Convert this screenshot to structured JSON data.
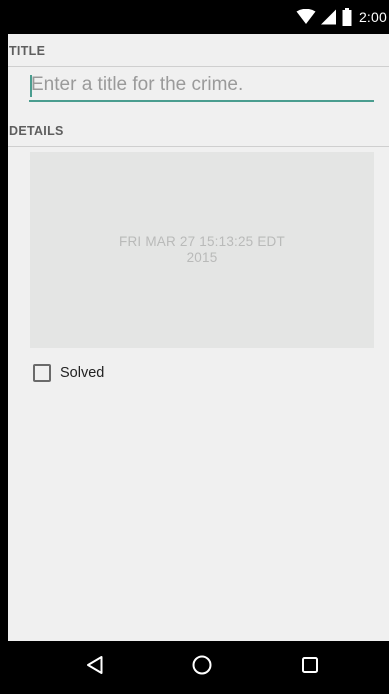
{
  "status_bar": {
    "time": "2:00",
    "icons": [
      "wifi-icon",
      "signal-icon",
      "battery-icon"
    ]
  },
  "crime_form": {
    "title_header": "TITLE",
    "title_input": {
      "value": "",
      "placeholder": "Enter a title for the crime."
    },
    "details_header": "DETAILS",
    "date_button": {
      "line1": "FRI MAR 27 15:13:25 EDT",
      "line2": "2015"
    },
    "solved_checkbox": {
      "label": "Solved",
      "checked": false
    }
  },
  "nav_bar": {
    "icons": [
      "back-icon",
      "home-icon",
      "recents-icon"
    ]
  },
  "colors": {
    "accent": "#4a9d8f",
    "background": "#f0f0f0",
    "date_button_bg": "#e4e5e4"
  }
}
